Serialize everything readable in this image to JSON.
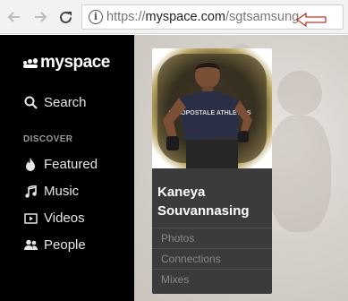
{
  "browser": {
    "url_scheme": "https://",
    "url_domain": "myspace.com",
    "url_path": "/sgtsamsung",
    "annotation_color": "#c0392b"
  },
  "sidebar": {
    "logo": "myspace",
    "search_label": "Search",
    "section_label": "DISCOVER",
    "items": [
      {
        "label": "Featured",
        "icon": "flame-icon"
      },
      {
        "label": "Music",
        "icon": "music-note-icon"
      },
      {
        "label": "Videos",
        "icon": "video-icon"
      },
      {
        "label": "People",
        "icon": "people-icon"
      }
    ]
  },
  "profile_card": {
    "name": "Kaneya Souvannasing",
    "shirt_text": "AEROPOSTALE ATHLETICS",
    "links": [
      "Photos",
      "Connections",
      "Mixes"
    ]
  }
}
